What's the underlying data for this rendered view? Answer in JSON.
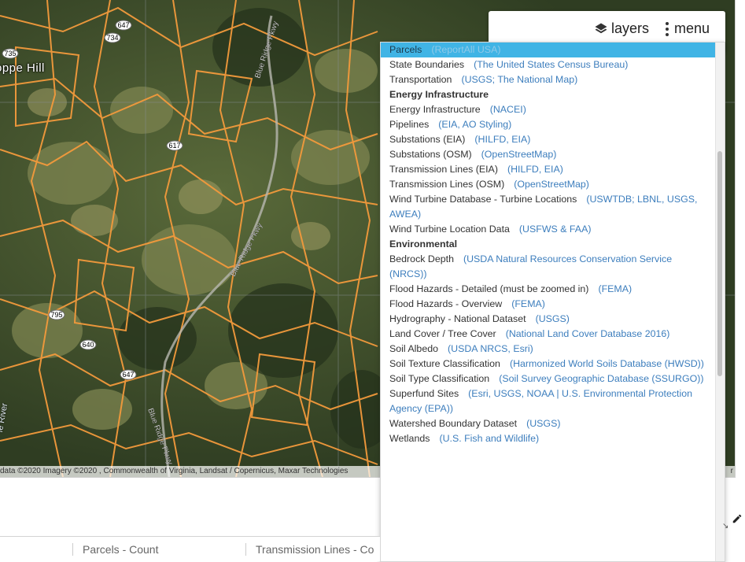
{
  "map": {
    "town_label": "oppe  Hill",
    "river_label": "ie River",
    "road_labels": [
      "Blue Ridge Pkwy",
      "Blue Ridge Pkwy",
      "Blue Ridge Pkwy"
    ],
    "shields": [
      "647",
      "734",
      "735",
      "617",
      "795",
      "640",
      "647"
    ],
    "attribution_left": "data ©2020 Imagery ©2020 , Commonwealth of Virginia, Landsat / Copernicus, Maxar Technologies",
    "attribution_right": "r"
  },
  "controls": {
    "layers_label": "layers",
    "menu_label": "menu"
  },
  "layers": {
    "items": [
      {
        "name": "Parcels",
        "source": "(ReportAll USA)",
        "selected": true
      },
      {
        "name": "State Boundaries",
        "source": "(The United States Census Bureau)"
      },
      {
        "name": "Transportation",
        "source": "(USGS; The National Map)"
      },
      {
        "header": "Energy Infrastructure"
      },
      {
        "name": "Energy Infrastructure",
        "source": "(NACEI)"
      },
      {
        "name": "Pipelines",
        "source": "(EIA, AO Styling)"
      },
      {
        "name": "Substations (EIA)",
        "source": "(HILFD, EIA)"
      },
      {
        "name": "Substations (OSM)",
        "source": "(OpenStreetMap)"
      },
      {
        "name": "Transmission Lines (EIA)",
        "source": "(HILFD, EIA)"
      },
      {
        "name": "Transmission Lines (OSM)",
        "source": "(OpenStreetMap)"
      },
      {
        "name": "Wind Turbine Database - Turbine Locations",
        "source": "(USWTDB; LBNL, USGS, AWEA)"
      },
      {
        "name": "Wind Turbine Location Data",
        "source": "(USFWS & FAA)"
      },
      {
        "header": "Environmental"
      },
      {
        "name": "Bedrock Depth",
        "source": "(USDA Natural Resources Conservation Service (NRCS))"
      },
      {
        "name": "Flood Hazards - Detailed (must be zoomed in)",
        "source": "(FEMA)"
      },
      {
        "name": "Flood Hazards - Overview",
        "source": "(FEMA)"
      },
      {
        "name": "Hydrography - National Dataset",
        "source": "(USGS)"
      },
      {
        "name": "Land Cover / Tree Cover",
        "source": "(National Land Cover Database 2016)"
      },
      {
        "name": "Soil Albedo",
        "source": "(USDA NRCS, Esri)"
      },
      {
        "name": "Soil Texture Classification",
        "source": "(Harmonized World Soils Database (HWSD))"
      },
      {
        "name": "Soil Type Classification",
        "source": "(Soil Survey Geographic Database (SSURGO))"
      },
      {
        "name": "Superfund Sites",
        "source": "(Esri, USGS, NOAA | U.S. Environmental Protection Agency (EPA))"
      },
      {
        "name": "Watershed Boundary Dataset",
        "source": "(USGS)"
      },
      {
        "name": "Wetlands",
        "source": "(U.S. Fish and Wildlife)"
      }
    ]
  },
  "table": {
    "col1": "Parcels - Count",
    "col2": "Transmission Lines - Co"
  },
  "colors": {
    "parcel_line": "#f39a3c",
    "selected_bg": "#40b4e5",
    "source_link": "#3d7ebd"
  }
}
